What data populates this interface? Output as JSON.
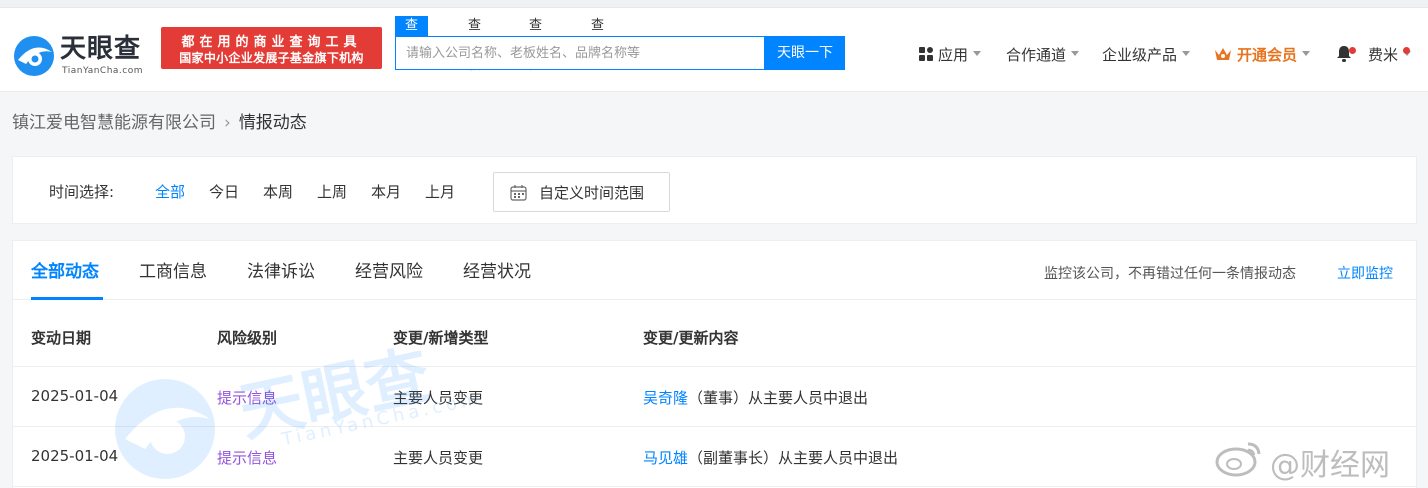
{
  "header": {
    "logo_text": "天眼查",
    "logo_sub": "TianYanCha.com",
    "slogan_line1": "都在用的商业查询工具",
    "slogan_line2": "国家中小企业发展子基金旗下机构",
    "search_tabs": [
      "查公司",
      "查老板",
      "查风险",
      "查关系"
    ],
    "search_placeholder": "请输入公司名称、老板姓名、品牌名称等",
    "search_button": "天眼一下",
    "nav": {
      "apps": "应用",
      "cooperation": "合作通道",
      "enterprise": "企业级产品",
      "vip": "开通会员",
      "user": "费米"
    }
  },
  "breadcrumb": {
    "company": "镇江爱电智慧能源有限公司",
    "current": "情报动态"
  },
  "filter": {
    "label": "时间选择:",
    "options": [
      "全部",
      "今日",
      "本周",
      "上周",
      "本月",
      "上月"
    ],
    "selected": "全部",
    "custom_range": "自定义时间范围"
  },
  "tabs": {
    "items": [
      "全部动态",
      "工商信息",
      "法律诉讼",
      "经营风险",
      "经营状况"
    ],
    "active": "全部动态"
  },
  "monitor": {
    "text": "监控该公司，不再错过任何一条情报动态",
    "link": "立即监控"
  },
  "table": {
    "headers": [
      "变动日期",
      "风险级别",
      "变更/新增类型",
      "变更/更新内容"
    ],
    "rows": [
      {
        "date": "2025-01-04",
        "risk": "提示信息",
        "type": "主要人员变更",
        "person": "吴奇隆",
        "detail": "（董事）从主要人员中退出"
      },
      {
        "date": "2025-01-04",
        "risk": "提示信息",
        "type": "主要人员变更",
        "person": "马见雄",
        "detail": "（副董事长）从主要人员中退出"
      }
    ]
  },
  "watermark": {
    "logo_text": "天眼查",
    "logo_sub": "TianYanCha.com",
    "weibo_text": "@财经网"
  },
  "colors": {
    "accent": "#0084ff",
    "slogan_bg": "#e33b36",
    "risk_hint": "#9254de",
    "vip": "#e8741f"
  }
}
